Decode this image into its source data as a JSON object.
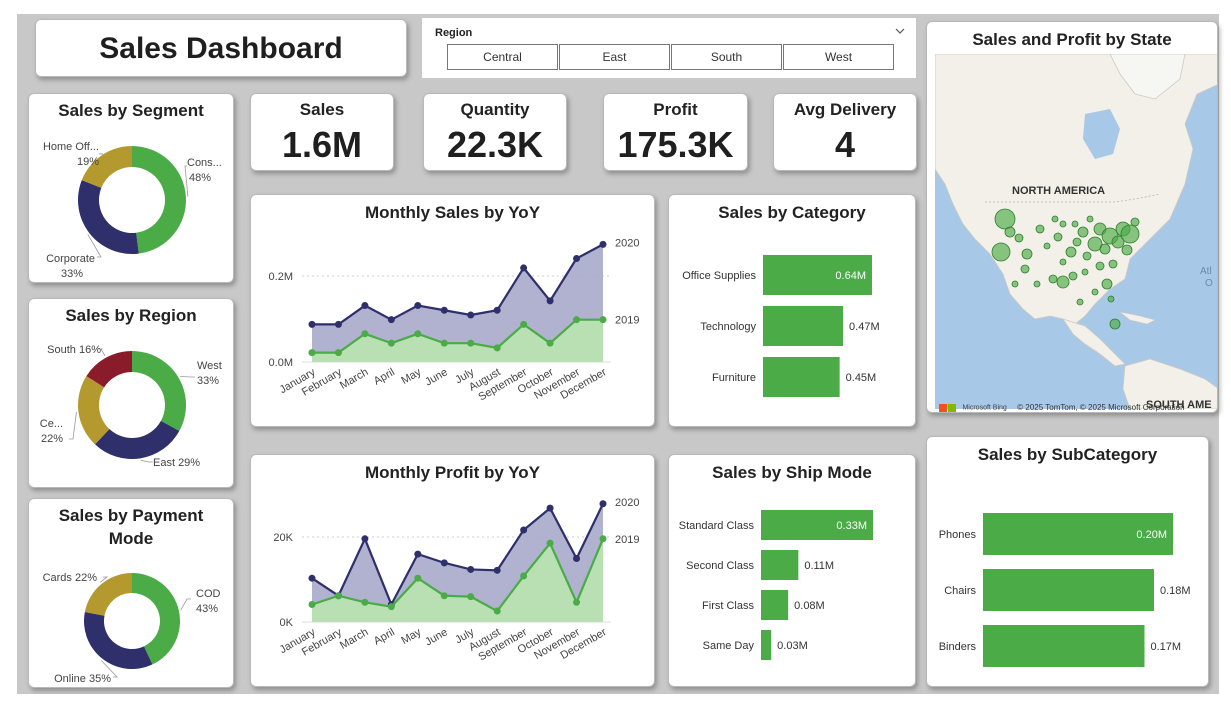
{
  "header": {
    "title": "Sales Dashboard"
  },
  "slicer": {
    "label": "Region",
    "options": [
      "Central",
      "East",
      "South",
      "West"
    ]
  },
  "kpis": [
    {
      "label": "Sales",
      "value": "1.6M"
    },
    {
      "label": "Quantity",
      "value": "22.3K"
    },
    {
      "label": "Profit",
      "value": "175.3K"
    },
    {
      "label": "Avg Delivery",
      "value": "4"
    }
  ],
  "colors": {
    "green": "#4aab47",
    "navy": "#2e2f6b",
    "gold": "#b49a2e",
    "maroon": "#8a1b2b",
    "area_navy": "#a9aacb",
    "area_green": "#b8e0b3",
    "map_water": "#a8c8e8",
    "map_land": "#f3f1ea"
  },
  "segment": {
    "title": "Sales by Segment",
    "slices": [
      {
        "label": "Cons...",
        "pct": "48%",
        "value": 48,
        "color": "#4aab47"
      },
      {
        "label": "Corporate",
        "pct": "33%",
        "value": 33,
        "color": "#2e2f6b"
      },
      {
        "label": "Home Off...",
        "pct": "19%",
        "value": 19,
        "color": "#b49a2e"
      }
    ]
  },
  "region": {
    "title": "Sales by Region",
    "slices": [
      {
        "label": "West",
        "pct": "33%",
        "value": 33,
        "color": "#4aab47"
      },
      {
        "label": "East",
        "pct": "29%",
        "value": 29,
        "color": "#2e2f6b"
      },
      {
        "label": "Ce...",
        "pct": "22%",
        "value": 22,
        "color": "#b49a2e"
      },
      {
        "label": "South",
        "pct": "16%",
        "value": 16,
        "color": "#8a1b2b"
      }
    ]
  },
  "payment": {
    "title_line1": "Sales by Payment",
    "title_line2": "Mode",
    "slices": [
      {
        "label": "COD",
        "pct": "43%",
        "value": 43,
        "color": "#4aab47"
      },
      {
        "label": "Online",
        "pct": "35%",
        "value": 35,
        "color": "#2e2f6b"
      },
      {
        "label": "Cards",
        "pct": "22%",
        "value": 22,
        "color": "#b49a2e"
      }
    ]
  },
  "chart_data": [
    {
      "type": "area",
      "title": "Monthly Sales by YoY",
      "categories": [
        "January",
        "February",
        "March",
        "April",
        "May",
        "June",
        "July",
        "August",
        "September",
        "October",
        "November",
        "December"
      ],
      "series": [
        {
          "name": "2020",
          "values": [
            0.08,
            0.08,
            0.12,
            0.09,
            0.12,
            0.11,
            0.1,
            0.11,
            0.2,
            0.13,
            0.22,
            0.25
          ]
        },
        {
          "name": "2019",
          "values": [
            0.02,
            0.02,
            0.06,
            0.04,
            0.06,
            0.04,
            0.04,
            0.03,
            0.08,
            0.04,
            0.09,
            0.09
          ]
        }
      ],
      "y_ticks": [
        "0.0M",
        "0.2M"
      ],
      "ylim": [
        0,
        0.27
      ]
    },
    {
      "type": "area",
      "title": "Monthly Profit by YoY",
      "categories": [
        "January",
        "February",
        "March",
        "April",
        "May",
        "June",
        "July",
        "August",
        "September",
        "October",
        "November",
        "December"
      ],
      "series": [
        {
          "name": "2020",
          "values": [
            10000,
            6000,
            19000,
            4000,
            15500,
            13500,
            12000,
            11800,
            21000,
            26000,
            14500,
            27000
          ]
        },
        {
          "name": "2019",
          "values": [
            4000,
            6000,
            4500,
            3500,
            10000,
            6000,
            5800,
            2500,
            10500,
            18000,
            4500,
            19000
          ]
        }
      ],
      "y_ticks": [
        "0K",
        "20K"
      ],
      "ylim": [
        0,
        29000
      ]
    },
    {
      "type": "bar",
      "title": "Sales by Category",
      "categories": [
        "Office Supplies",
        "Technology",
        "Furniture"
      ],
      "values": [
        0.64,
        0.47,
        0.45
      ],
      "labels": [
        "0.64M",
        "0.47M",
        "0.45M"
      ]
    },
    {
      "type": "bar",
      "title": "Sales by Ship Mode",
      "categories": [
        "Standard Class",
        "Second Class",
        "First Class",
        "Same Day"
      ],
      "values": [
        0.33,
        0.11,
        0.08,
        0.03
      ],
      "labels": [
        "0.33M",
        "0.11M",
        "0.08M",
        "0.03M"
      ]
    },
    {
      "type": "bar",
      "title": "Sales by SubCategory",
      "categories": [
        "Phones",
        "Chairs",
        "Binders"
      ],
      "values": [
        0.2,
        0.18,
        0.17
      ],
      "labels": [
        "0.20M",
        "0.18M",
        "0.17M"
      ]
    }
  ],
  "map": {
    "title": "Sales and Profit by State",
    "label_na": "NORTH AMERICA",
    "label_sa": "SOUTH AME",
    "label_atl": "Atl",
    "label_atl2": "O",
    "attribution": "© 2025 TomTom, © 2025 Microsoft Corporation",
    "bing": "Microsoft Bing"
  }
}
